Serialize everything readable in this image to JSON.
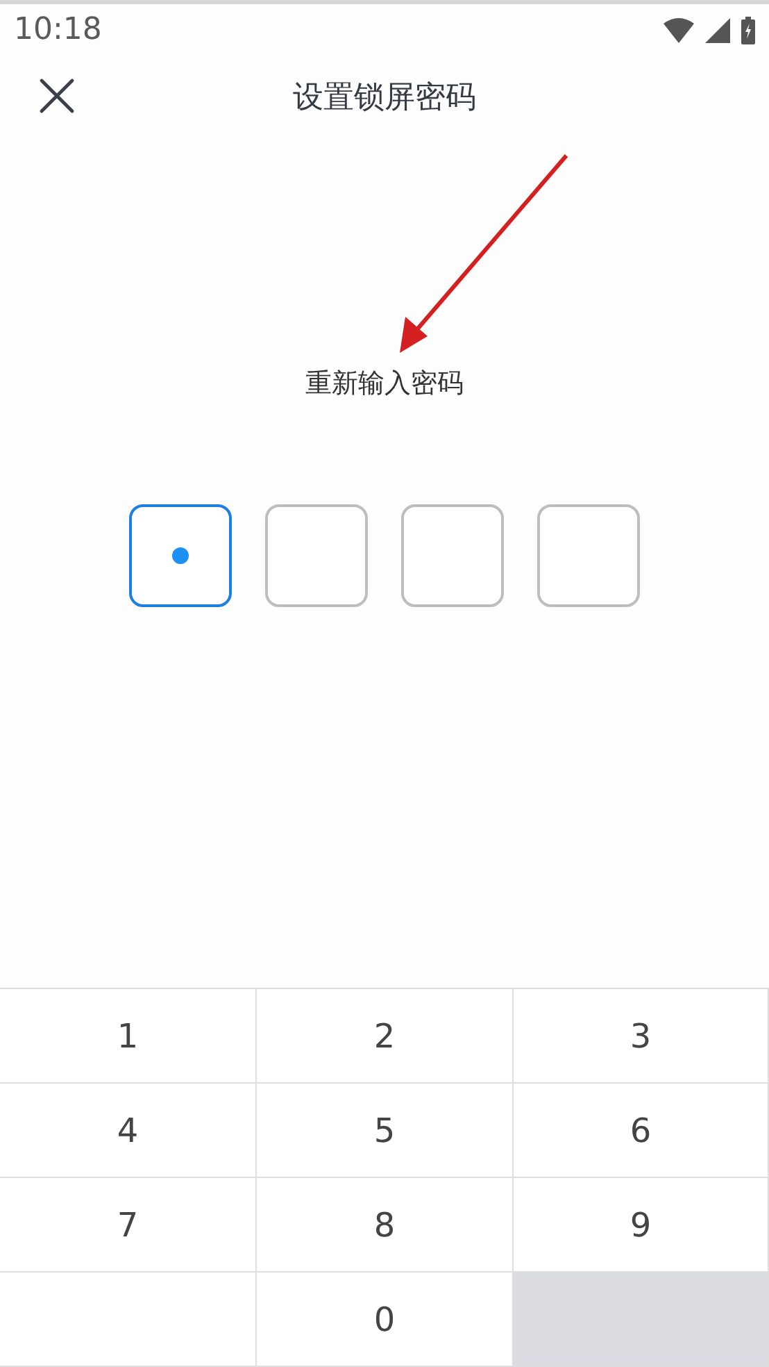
{
  "status_bar": {
    "time": "10:18"
  },
  "header": {
    "title": "设置锁屏密码"
  },
  "prompt": "重新输入密码",
  "pin_boxes": [
    {
      "filled": true,
      "selected": true
    },
    {
      "filled": false,
      "selected": false
    },
    {
      "filled": false,
      "selected": false
    },
    {
      "filled": false,
      "selected": false
    }
  ],
  "keypad": [
    {
      "kind": "digit",
      "label": "1"
    },
    {
      "kind": "digit",
      "label": "2"
    },
    {
      "kind": "digit",
      "label": "3"
    },
    {
      "kind": "digit",
      "label": "4"
    },
    {
      "kind": "digit",
      "label": "5"
    },
    {
      "kind": "digit",
      "label": "6"
    },
    {
      "kind": "digit",
      "label": "7"
    },
    {
      "kind": "digit",
      "label": "8"
    },
    {
      "kind": "digit",
      "label": "9"
    },
    {
      "kind": "blank"
    },
    {
      "kind": "digit",
      "label": "0"
    },
    {
      "kind": "action"
    }
  ]
}
